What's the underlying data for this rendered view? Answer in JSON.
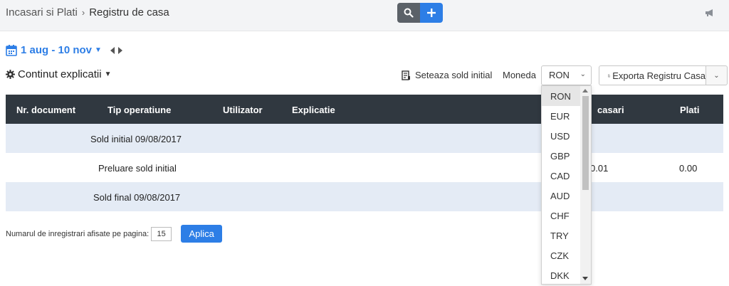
{
  "header": {
    "breadcrumb_root": "Incasari si Plati",
    "breadcrumb_separator": "›",
    "page_title": "Registru de casa",
    "search_icon": "search-icon",
    "add_icon": "plus-icon",
    "announce_icon": "megaphone-icon"
  },
  "filters": {
    "date_range": "1 aug - 10 nov",
    "explanations_label": "Continut explicatii"
  },
  "toolbar": {
    "set_initial_balance": "Seteaza sold initial",
    "currency_label": "Moneda",
    "currency_selected": "RON",
    "export_label": "Exporta Registru Casa"
  },
  "table": {
    "columns": [
      "Nr. document",
      "Tip operatiune",
      "Utilizator",
      "Explicatie",
      "Incasari",
      "Plati"
    ],
    "columns_visible": [
      "Nr. document",
      "Tip operatiune",
      "Utilizator",
      "Explicatie",
      "casari",
      "Plati"
    ],
    "rows": [
      {
        "doc": "",
        "type": "Sold initial 09/08/2017",
        "user": "",
        "explanation": "",
        "incasari": "",
        "plati": ""
      },
      {
        "doc": "",
        "type": "Preluare sold initial",
        "user": "",
        "explanation": "",
        "incasari": "0.01",
        "plati": "0.00"
      },
      {
        "doc": "",
        "type": "Sold final 09/08/2017",
        "user": "",
        "explanation": "",
        "incasari": "",
        "plati": ""
      }
    ]
  },
  "footer": {
    "per_page_label": "Numarul de inregistrari afisate pe pagina:",
    "per_page_value": "15",
    "apply_label": "Aplica"
  },
  "currency_dropdown": {
    "options": [
      "RON",
      "EUR",
      "USD",
      "GBP",
      "CAD",
      "AUD",
      "CHF",
      "TRY",
      "CZK",
      "DKK"
    ]
  },
  "colors": {
    "accent": "#2d7ee6",
    "table_header": "#303840",
    "alt_row": "#e4ebf5"
  }
}
